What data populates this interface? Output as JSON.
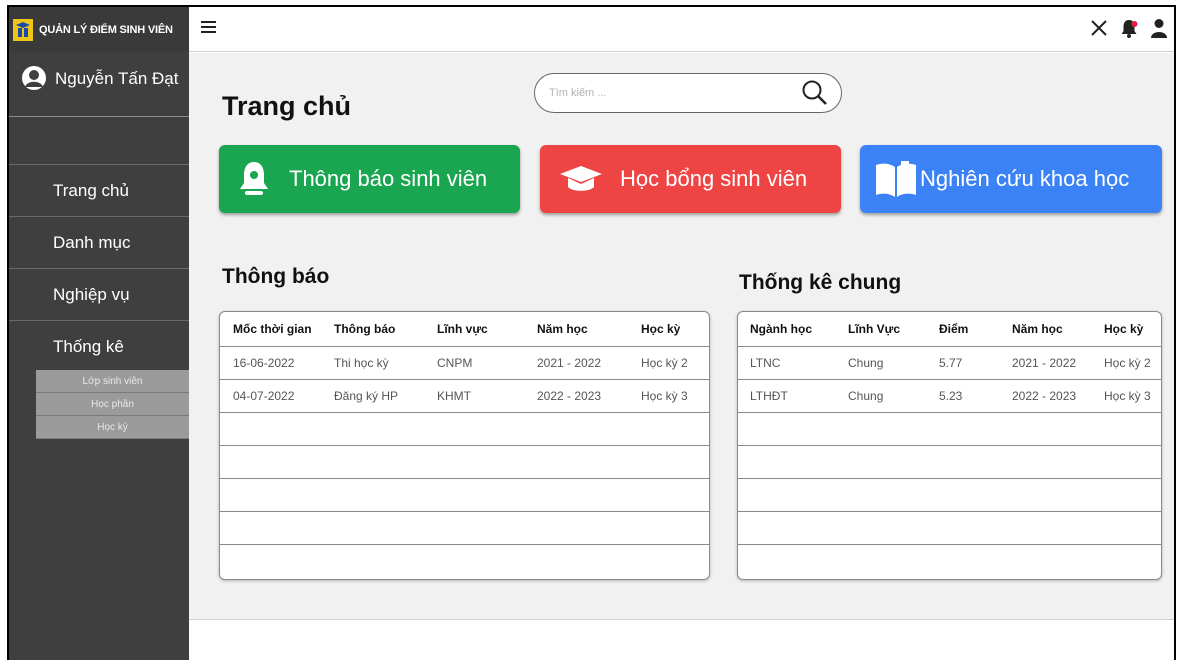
{
  "app": {
    "brand": "QUẢN LÝ ĐIỂM SINH VIÊN"
  },
  "user": {
    "name": "Nguyễn Tấn Đạt"
  },
  "nav": {
    "items": [
      {
        "label": "Trang chủ"
      },
      {
        "label": "Danh mục"
      },
      {
        "label": "Nghiệp vụ"
      },
      {
        "label": "Thống kê"
      }
    ],
    "subitems": [
      {
        "label": "Lớp sinh viên"
      },
      {
        "label": "Học phần"
      },
      {
        "label": "Học kỳ"
      }
    ]
  },
  "topbar": {
    "icons": [
      "menu-icon",
      "close-icon",
      "bell-icon",
      "user-icon"
    ],
    "notification_dot_color": "#e11d48"
  },
  "page": {
    "title": "Trang chủ"
  },
  "search": {
    "placeholder": "Tìm kiếm ..."
  },
  "cards": [
    {
      "label": "Thông báo sinh viên",
      "icon": "bell-icon",
      "color": "#1aa550"
    },
    {
      "label": "Học bổng sinh viên",
      "icon": "graduation-cap-icon",
      "color": "#ef4444"
    },
    {
      "label": "Nghiên cứu khoa học",
      "icon": "book-icon",
      "color": "#3b82f6"
    }
  ],
  "notifications": {
    "title": "Thông báo",
    "columns": [
      "Mốc thời gian",
      "Thông báo",
      "Lĩnh vực",
      "Năm học",
      "Học kỳ"
    ],
    "rows": [
      [
        "16-06-2022",
        "Thi học kỳ",
        "CNPM",
        "2021 - 2022",
        "Học kỳ 2"
      ],
      [
        "04-07-2022",
        "Đăng ký HP",
        "KHMT",
        "2022 - 2023",
        "Học kỳ 3"
      ],
      [
        "",
        "",
        "",
        "",
        ""
      ],
      [
        "",
        "",
        "",
        "",
        ""
      ],
      [
        "",
        "",
        "",
        "",
        ""
      ],
      [
        "",
        "",
        "",
        "",
        ""
      ],
      [
        "",
        "",
        "",
        "",
        ""
      ]
    ]
  },
  "stats": {
    "title": "Thống kê chung",
    "columns": [
      "Ngành học",
      "Lĩnh Vực",
      "Điểm",
      "Năm học",
      "Học kỳ"
    ],
    "rows": [
      [
        "LTNC",
        "Chung",
        "5.77",
        "2021 - 2022",
        "Học kỳ 2"
      ],
      [
        "LTHĐT",
        "Chung",
        "5.23",
        "2022 - 2023",
        "Học kỳ 3"
      ],
      [
        "",
        "",
        "",
        "",
        ""
      ],
      [
        "",
        "",
        "",
        "",
        ""
      ],
      [
        "",
        "",
        "",
        "",
        ""
      ],
      [
        "",
        "",
        "",
        "",
        ""
      ],
      [
        "",
        "",
        "",
        "",
        ""
      ]
    ]
  }
}
